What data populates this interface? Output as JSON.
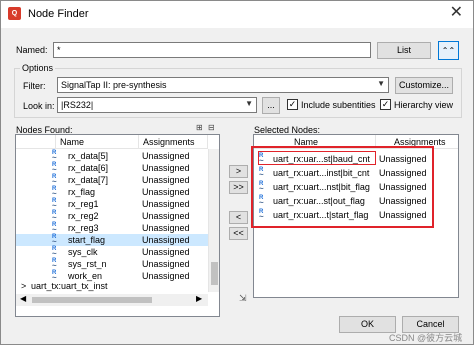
{
  "window": {
    "title": "Node Finder",
    "close_glyph": "✕"
  },
  "named": {
    "label": "Named:",
    "value": "*",
    "list_button": "List",
    "collapse_glyph": "⌃⌃"
  },
  "options": {
    "group_label": "Options",
    "filter_label": "Filter:",
    "filter_value": "SignalTap II: pre-synthesis",
    "customize_button": "Customize...",
    "lookin_label": "Look in:",
    "lookin_value": "|RS232|",
    "browse_button": "...",
    "include_subentities": {
      "label": "Include subentities",
      "checked": true
    },
    "hierarchy_view": {
      "label": "Hierarchy view",
      "checked": true
    }
  },
  "nodes_found": {
    "label": "Nodes Found:",
    "columns": [
      "Name",
      "Assignments"
    ],
    "rows": [
      {
        "name": "rx_data[5]",
        "assignment": "Unassigned",
        "selected": false
      },
      {
        "name": "rx_data[6]",
        "assignment": "Unassigned",
        "selected": false
      },
      {
        "name": "rx_data[7]",
        "assignment": "Unassigned",
        "selected": false
      },
      {
        "name": "rx_flag",
        "assignment": "Unassigned",
        "selected": false
      },
      {
        "name": "rx_reg1",
        "assignment": "Unassigned",
        "selected": false
      },
      {
        "name": "rx_reg2",
        "assignment": "Unassigned",
        "selected": false
      },
      {
        "name": "rx_reg3",
        "assignment": "Unassigned",
        "selected": false
      },
      {
        "name": "start_flag",
        "assignment": "Unassigned",
        "selected": true
      },
      {
        "name": "sys_clk",
        "assignment": "Unassigned",
        "selected": false
      },
      {
        "name": "sys_rst_n",
        "assignment": "Unassigned",
        "selected": false
      },
      {
        "name": "work_en",
        "assignment": "Unassigned",
        "selected": false
      }
    ],
    "tree_item": {
      "expander": ">",
      "label": "uart_tx:uart_tx_inst"
    }
  },
  "transfer_buttons": [
    ">",
    ">>",
    "<",
    "<<"
  ],
  "selected_nodes": {
    "label": "Selected Nodes:",
    "columns": [
      "Name",
      "Assignments"
    ],
    "rows": [
      {
        "name": "uart_rx:uar...st|baud_cnt",
        "assignment": "Unassigned"
      },
      {
        "name": "uart_rx:uart...inst|bit_cnt",
        "assignment": "Unassigned"
      },
      {
        "name": "uart_rx:uart...nst|bit_flag",
        "assignment": "Unassigned"
      },
      {
        "name": "uart_rx:uar...st|out_flag",
        "assignment": "Unassigned"
      },
      {
        "name": "uart_rx:uart...t|start_flag",
        "assignment": "Unassigned"
      }
    ]
  },
  "footer": {
    "ok_button": "OK",
    "cancel_button": "Cancel"
  },
  "watermark": "CSDN @彼方云城",
  "colors": {
    "highlight": "#e0232a",
    "selection": "#cce8ff",
    "accent": "#0078d7"
  }
}
